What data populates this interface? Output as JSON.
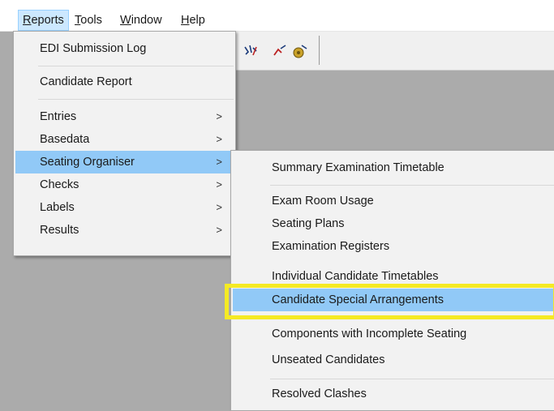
{
  "menubar": {
    "items": [
      {
        "prefix": "",
        "accel": "R",
        "rest": "eports"
      },
      {
        "prefix": "",
        "accel": "T",
        "rest": "ools"
      },
      {
        "prefix": "",
        "accel": "W",
        "rest": "indow"
      },
      {
        "prefix": "",
        "accel": "H",
        "rest": "elp"
      }
    ]
  },
  "reports_menu": {
    "items": [
      {
        "label": "EDI Submission Log"
      },
      {
        "label": "Candidate Report"
      },
      {
        "label": "Entries",
        "arrow": ">"
      },
      {
        "label": "Basedata",
        "arrow": ">"
      },
      {
        "label": "Seating Organiser",
        "arrow": ">"
      },
      {
        "label": "Checks",
        "arrow": ">"
      },
      {
        "label": "Labels",
        "arrow": ">"
      },
      {
        "label": "Results",
        "arrow": ">"
      }
    ]
  },
  "seating_submenu": {
    "items": [
      {
        "label": "Summary Examination Timetable"
      },
      {
        "label": "Exam Room Usage"
      },
      {
        "label": "Seating Plans"
      },
      {
        "label": "Examination Registers"
      },
      {
        "label": "Individual Candidate Timetables"
      },
      {
        "label": "Candidate Special Arrangements"
      },
      {
        "label": "Components with Incomplete Seating"
      },
      {
        "label": "Unseated Candidates"
      },
      {
        "label": "Resolved Clashes"
      }
    ]
  },
  "colors": {
    "menu_highlight": "#91c9f7",
    "emphasis_box": "#f5ea24",
    "workspace": "#ababab"
  }
}
